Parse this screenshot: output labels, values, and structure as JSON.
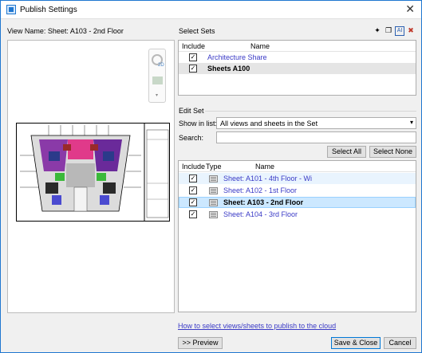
{
  "window": {
    "title": "Publish Settings",
    "close_glyph": "✕"
  },
  "preview": {
    "view_name": "View Name: Sheet: A103 - 2nd Floor",
    "navwheel_label": "2D"
  },
  "select_sets": {
    "label": "Select Sets",
    "columns": {
      "include": "Include",
      "name": "Name"
    },
    "rows": [
      {
        "checked": true,
        "name": "Architecture Share",
        "style": "link"
      },
      {
        "checked": true,
        "name": "Sheets A100",
        "style": "bold"
      }
    ],
    "toolbar_icons": [
      "new-set-icon",
      "duplicate-set-icon",
      "rename-set-icon",
      "delete-set-icon"
    ]
  },
  "edit_set": {
    "label": "Edit Set",
    "show_in_list_label": "Show in list:",
    "show_in_list_value": "All views and sheets in the Set",
    "search_label": "Search:",
    "search_value": "",
    "select_all": "Select All",
    "select_none": "Select None",
    "columns": {
      "include": "Include",
      "type": "Type",
      "name": "Name"
    },
    "rows": [
      {
        "checked": true,
        "name": "Sheet: A101 - 4th Floor - Wi",
        "style": "link"
      },
      {
        "checked": true,
        "name": "Sheet: A102 - 1st Floor",
        "style": "link"
      },
      {
        "checked": true,
        "name": "Sheet: A103 - 2nd Floor",
        "style": "bold"
      },
      {
        "checked": true,
        "name": "Sheet: A104 - 3rd Floor",
        "style": "link"
      }
    ]
  },
  "footer": {
    "help_link": "How to select views/sheets to publish to the cloud",
    "preview_button": ">> Preview",
    "save_close": "Save & Close",
    "cancel": "Cancel"
  },
  "colors": {
    "accent": "#0078d7",
    "link": "#3a3ac6",
    "selected_row": "#cce8ff"
  }
}
